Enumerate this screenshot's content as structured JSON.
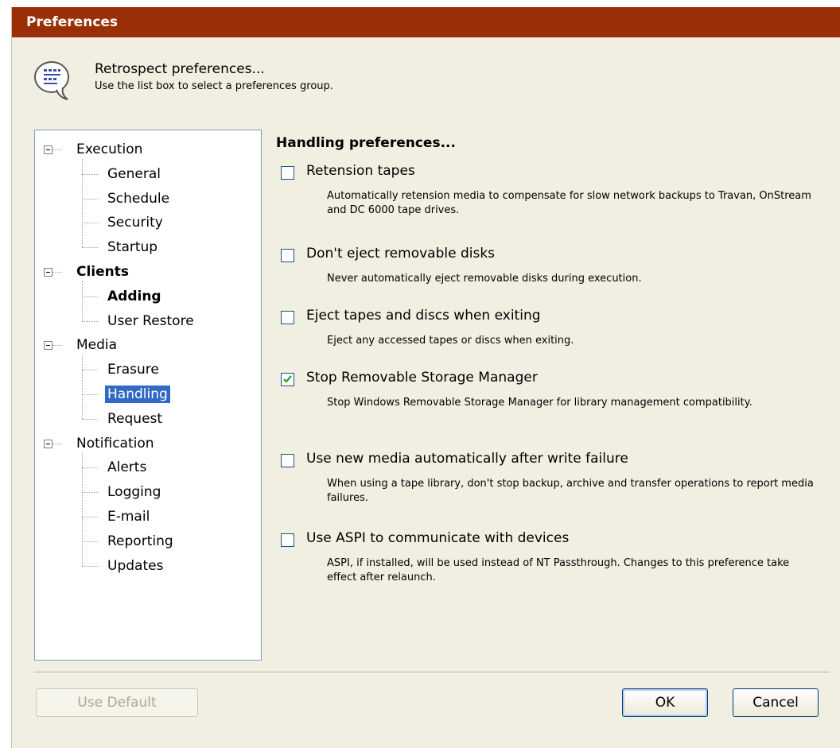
{
  "window": {
    "title": "Preferences"
  },
  "info": {
    "title": "Retrospect preferences...",
    "subtitle": "Use the list box to select a preferences group.",
    "icon": "speech-bubble-list-icon"
  },
  "tree": {
    "groups": [
      {
        "label": "Execution",
        "bold": false,
        "children": [
          "General",
          "Schedule",
          "Security",
          "Startup"
        ]
      },
      {
        "label": "Clients",
        "bold": true,
        "children": [
          "Adding",
          "User Restore"
        ]
      },
      {
        "label": "Media",
        "bold": false,
        "children": [
          "Erasure",
          "Handling",
          "Request"
        ]
      },
      {
        "label": "Notification",
        "bold": false,
        "children": [
          "Alerts",
          "Logging",
          "E-mail",
          "Reporting",
          "Updates"
        ]
      }
    ],
    "selected": "Handling",
    "bold_child": "Adding"
  },
  "section": {
    "title": "Handling preferences..."
  },
  "options": [
    {
      "label": "Retension tapes",
      "checked": false,
      "desc": "Automatically retension media to compensate for slow network backups to Travan, OnStream and DC 6000 tape drives."
    },
    {
      "label": "Don't eject removable disks",
      "checked": false,
      "desc": "Never automatically eject removable disks during execution."
    },
    {
      "label": "Eject tapes and discs when exiting",
      "checked": false,
      "desc": "Eject any accessed tapes or discs when exiting."
    },
    {
      "label": "Stop Removable Storage Manager",
      "checked": true,
      "desc": "Stop Windows Removable Storage Manager for library management compatibility."
    },
    {
      "label": "Use new media automatically after write failure",
      "checked": false,
      "desc": "When using a tape library, don't stop backup, archive and transfer operations to report media failures."
    },
    {
      "label": "Use ASPI to communicate with devices",
      "checked": false,
      "desc": "ASPI, if installed, will be used instead of NT Passthrough. Changes to this preference take effect after relaunch."
    }
  ],
  "buttons": {
    "use_default": "Use Default",
    "ok": "OK",
    "cancel": "Cancel"
  },
  "colors": {
    "titlebar": "#9a2f05",
    "dialog_bg": "#f1efe2",
    "selection": "#316ac5",
    "check": "#21a121"
  }
}
